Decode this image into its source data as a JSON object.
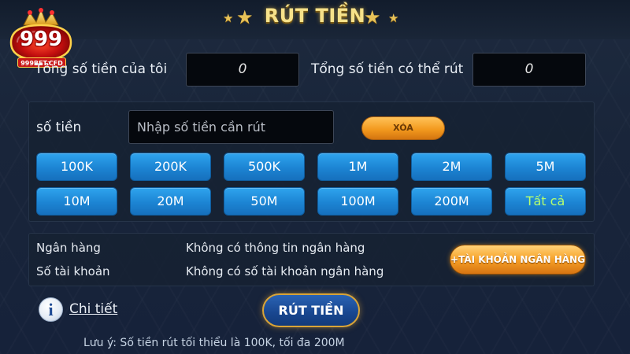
{
  "header": {
    "title": "RÚT TIỀN"
  },
  "logo": {
    "number": "999",
    "domain": "999BET.CFD"
  },
  "balance": {
    "my_label": "Tổng số tiền của tôi",
    "my_value": "0",
    "withdrawable_label": "Tổng số tiền có thể rút",
    "withdrawable_value": "0"
  },
  "amount": {
    "label": "số tiền",
    "placeholder": "Nhập số tiền cần rút",
    "clear_label": "XÓA",
    "options": [
      "100K",
      "200K",
      "500K",
      "1M",
      "2M",
      "5M",
      "10M",
      "20M",
      "50M",
      "100M",
      "200M",
      "Tất cả"
    ]
  },
  "bank": {
    "bank_label": "Ngân hàng",
    "bank_value": "Không có thông tin ngân hàng",
    "account_label": "Số tài khoản",
    "account_value": "Không có số tài khoản ngân hàng",
    "add_button": "+TÀI KHOẢN NGÂN HÀNG"
  },
  "footer": {
    "detail_link": "Chi tiết",
    "withdraw_button": "RÚT TIỀN",
    "note": "Lưu ý: Số tiền rút tối thiểu là 100K, tối đa 200M"
  },
  "colors": {
    "gold": "#f7e28a",
    "button_blue": "#1c84d3",
    "button_orange": "#f39a1e",
    "all_green": "#b7ff6e"
  },
  "icons": {
    "info": "info-icon",
    "stars": "star-icon",
    "logo": "crown-logo-icon"
  }
}
